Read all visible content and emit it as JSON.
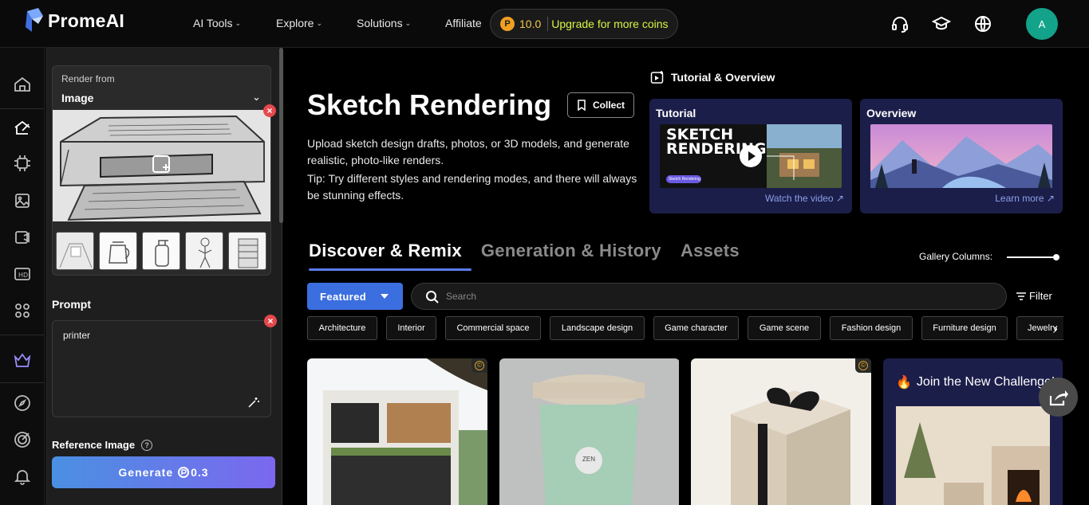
{
  "brand": {
    "name": "PromeAI"
  },
  "nav": {
    "items": [
      {
        "label": "AI Tools",
        "has_dropdown": true
      },
      {
        "label": "Explore",
        "has_dropdown": true
      },
      {
        "label": "Solutions",
        "has_dropdown": true
      },
      {
        "label": "Affiliate",
        "has_dropdown": false
      }
    ],
    "coins": {
      "value": "10.0",
      "upgrade_label": "Upgrade for more coins"
    },
    "icons": [
      "headset-icon",
      "graduation-cap-icon",
      "globe-icon"
    ],
    "avatar_initial": "A"
  },
  "rail": {
    "icons": [
      "home-icon",
      "sketch-render-icon",
      "chip-icon",
      "image-icon",
      "video-icon",
      "hd-icon",
      "apps-grid-icon",
      "crown-icon",
      "compass-icon",
      "target-icon",
      "bell-icon"
    ]
  },
  "panel": {
    "render_from_label": "Render from",
    "render_from_value": "Image",
    "prompt_label": "Prompt",
    "prompt_value": "printer",
    "reference_label": "Reference Image",
    "help_glyph": "?",
    "generate_label": "Generate",
    "generate_cost": "0.3",
    "thumbs": [
      "interior-thumb",
      "kettle-thumb",
      "bottle-thumb",
      "figure-thumb",
      "building-thumb"
    ]
  },
  "main": {
    "title": "Sketch Rendering",
    "collect_label": "Collect",
    "description": "Upload sketch design drafts, photos, or 3D models, and generate realistic, photo-like renders.",
    "tip": "Tip: Try different styles and rendering modes, and there will always be stunning effects."
  },
  "tutorial": {
    "heading": "Tutorial & Overview",
    "cards": [
      {
        "title": "Tutorial",
        "link": "Watch the video ↗",
        "image_text_1": "SKETCH",
        "image_text_2": "RENDERING",
        "image_badge": "Sketch Rendering"
      },
      {
        "title": "Overview",
        "link": "Learn more ↗"
      }
    ]
  },
  "tabs": [
    {
      "label": "Discover & Remix",
      "active": true
    },
    {
      "label": "Generation & History",
      "active": false
    },
    {
      "label": "Assets",
      "active": false
    }
  ],
  "gallery": {
    "columns_label": "Gallery Columns:"
  },
  "filters": {
    "featured_label": "Featured",
    "search_placeholder": "Search",
    "filter_label": "Filter",
    "chips": [
      "Architecture",
      "Interior",
      "Commercial space",
      "Landscape design",
      "Game character",
      "Game scene",
      "Fashion design",
      "Furniture design",
      "Jewelry"
    ]
  },
  "cards": {
    "coin_glyph": "©",
    "cup_text": "ZEN",
    "challenge_title": "Join the New Challenge!"
  },
  "colors": {
    "accent": "#3b6fe0",
    "coin": "#f2c94c",
    "upgrade": "#d7f542",
    "card_navy": "#1c1e4a",
    "danger": "#e5484d"
  }
}
